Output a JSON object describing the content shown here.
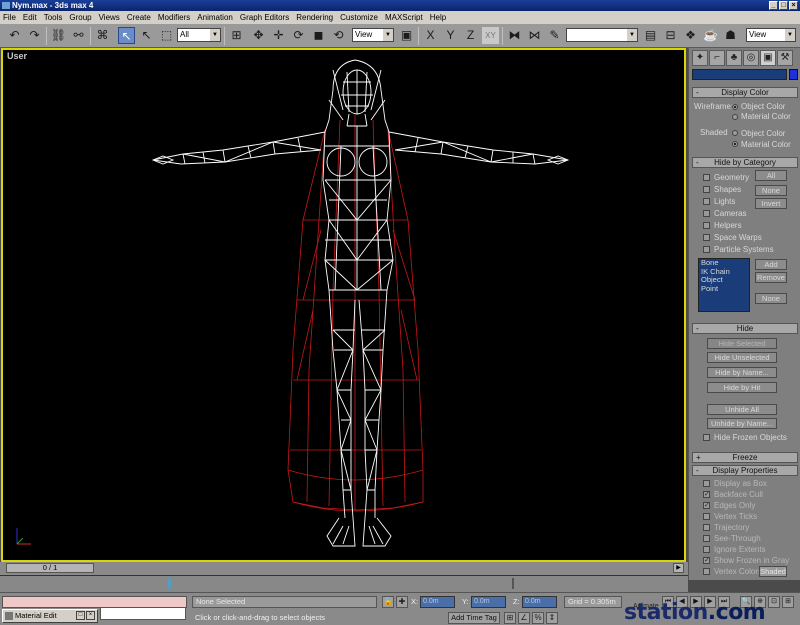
{
  "window": {
    "title": "Nym.max - 3ds max 4",
    "controls": [
      "_",
      "□",
      "×"
    ]
  },
  "menu": [
    "File",
    "Edit",
    "Tools",
    "Group",
    "Views",
    "Create",
    "Modifiers",
    "Animation",
    "Graph Editors",
    "Rendering",
    "Customize",
    "MAXScript",
    "Help"
  ],
  "toolbar": {
    "selection_filter": "All",
    "reference_coord": "View",
    "named_selection": "",
    "render_type": "View",
    "constraint_labels": [
      "X",
      "Y",
      "Z",
      "XY"
    ]
  },
  "viewport": {
    "label": "User",
    "active_border_color": "#d8d800",
    "mesh_color": "#ffffff",
    "cloak_color": "#c81818"
  },
  "command_panel": {
    "tabs": [
      "create-icon",
      "modify-icon",
      "hierarchy-icon",
      "motion-icon",
      "display-icon",
      "utilities-icon"
    ],
    "display_color": {
      "header": "Display Color",
      "wireframe_label": "Wireframe:",
      "shaded_label": "Shaded",
      "object_color": "Object Color",
      "material_color": "Material Color"
    },
    "hide_by_category": {
      "header": "Hide by Category",
      "categories": [
        "Geometry",
        "Shapes",
        "Lights",
        "Cameras",
        "Helpers",
        "Space Warps",
        "Particle Systems"
      ],
      "all_btn": "All",
      "none_btn": "None",
      "invert_btn": "Invert",
      "list": [
        "Bone",
        "IK Chain Object",
        "Point"
      ],
      "add_btn": "Add",
      "remove_btn": "Remove",
      "none2_btn": "None"
    },
    "hide": {
      "header": "Hide",
      "hide_selected": "Hide Selected",
      "hide_unselected": "Hide Unselected",
      "hide_by_name": "Hide by Name...",
      "hide_by_hit": "Hide by Hit",
      "unhide_all": "Unhide All",
      "unhide_by_name": "Unhide by Name...",
      "hide_frozen": "Hide Frozen Objects"
    },
    "freeze": {
      "header": "Freeze"
    },
    "display_properties": {
      "header": "Display Properties",
      "items": [
        "Display as Box",
        "Backface Cull",
        "Edges Only",
        "Vertex Ticks",
        "Trajectory",
        "See-Through",
        "Ignore Extents",
        "Show Frozen in Gray",
        "Vertex Colors"
      ],
      "shaded_btn": "Shaded"
    }
  },
  "timeline": {
    "frame_slider": "0 / 1"
  },
  "status": {
    "selection": "None Selected",
    "prompt": "Click or click-and-drag to select objects",
    "x_label": "X:",
    "y_label": "Y:",
    "z_label": "Z:",
    "x_value": "0.0m",
    "y_value": "0.0m",
    "z_value": "0.0m",
    "grid": "Grid = 0.305m",
    "add_time_tag": "Add Time Tag",
    "animate_label": "Animate"
  },
  "taskbar": {
    "item": "Material Edit"
  },
  "watermark": {
    "text": "station",
    "suffix": ".com"
  }
}
